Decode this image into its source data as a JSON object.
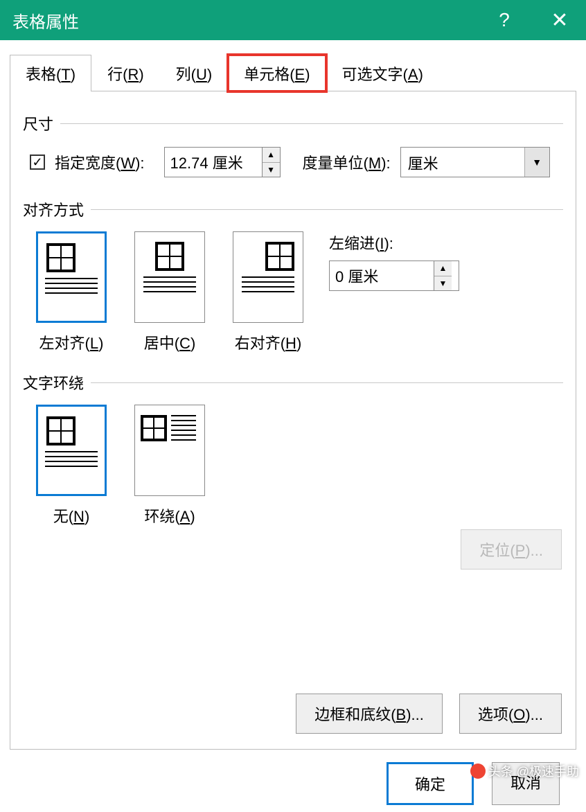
{
  "titlebar": {
    "title": "表格属性"
  },
  "tabs": {
    "table": "表格(T)",
    "row": "行(R)",
    "column": "列(U)",
    "cell": "单元格(E)",
    "alttext": "可选文字(A)"
  },
  "size": {
    "group_label": "尺寸",
    "specify_width_label": "指定宽度(W):",
    "width_value": "12.74 厘米",
    "unit_label": "度量单位(M):",
    "unit_value": "厘米"
  },
  "align": {
    "group_label": "对齐方式",
    "left": "左对齐(L)",
    "center": "居中(C)",
    "right": "右对齐(H)",
    "indent_label": "左缩进(I):",
    "indent_value": "0 厘米"
  },
  "wrap": {
    "group_label": "文字环绕",
    "none": "无(N)",
    "around": "环绕(A)",
    "locate": "定位(P)..."
  },
  "buttons": {
    "borders": "边框和底纹(B)...",
    "options": "选项(O)...",
    "ok": "确定",
    "cancel": "取消"
  },
  "watermark": "头条 @极速手助"
}
